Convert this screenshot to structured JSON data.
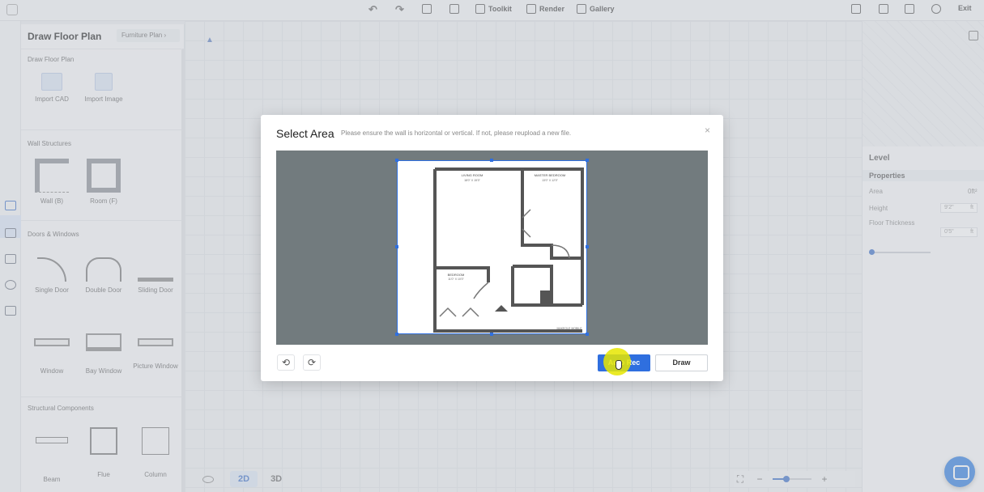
{
  "toolbar": {
    "toolkit_label": "Toolkit",
    "render_label": "Render",
    "gallery_label": "Gallery",
    "exit_label": "Exit"
  },
  "left_panel": {
    "title": "Draw Floor Plan",
    "furniture_tab": "Furniture Plan",
    "sections": {
      "draw": "Draw Floor Plan",
      "walls": "Wall Structures",
      "doors": "Doors & Windows",
      "structural": "Structural Components"
    },
    "draw_items": [
      "Import CAD",
      "Import Image"
    ],
    "wall_items": [
      "Wall (B)",
      "Room (F)"
    ],
    "door_items": [
      "Single Door",
      "Double Door",
      "Sliding Door"
    ],
    "window_items": [
      "Window",
      "Bay Window",
      "Picture Window"
    ],
    "structural_items": [
      "Beam",
      "Flue",
      "Column"
    ]
  },
  "canvas": {
    "view_2d": "2D",
    "view_3d": "3D",
    "zoom_level": 0.35
  },
  "right_panel": {
    "level": "Level",
    "properties": "Properties",
    "area_label": "Area",
    "area_value": "0ft²",
    "height_label": "Height",
    "height_value": "9'2\"",
    "height_unit": "ft",
    "thickness_label": "Floor Thickness",
    "thickness_value": "0'5\"",
    "thickness_unit": "ft",
    "thickness_level": 0.0
  },
  "dialog": {
    "title": "Select Area",
    "hint": "Please ensure the wall is horizontal or vertical. If not, please reupload a new file.",
    "close_glyph": "×",
    "rotate_left_glyph": "⟲",
    "rotate_right_glyph": "⟳",
    "auto_rec_label": "Auto Rec",
    "draw_label": "Draw",
    "plan_labels": {
      "living": "LIVING ROOM",
      "living_dim": "18'0\" X 15'0\"",
      "master": "MASTER BEDROOM",
      "master_dim": "13'0\" X 12'0\"",
      "bedroom": "BEDROOM",
      "bedroom_dim": "11'0\" X 10'0\"",
      "footer": "MAKEOLE MOBILE"
    }
  }
}
